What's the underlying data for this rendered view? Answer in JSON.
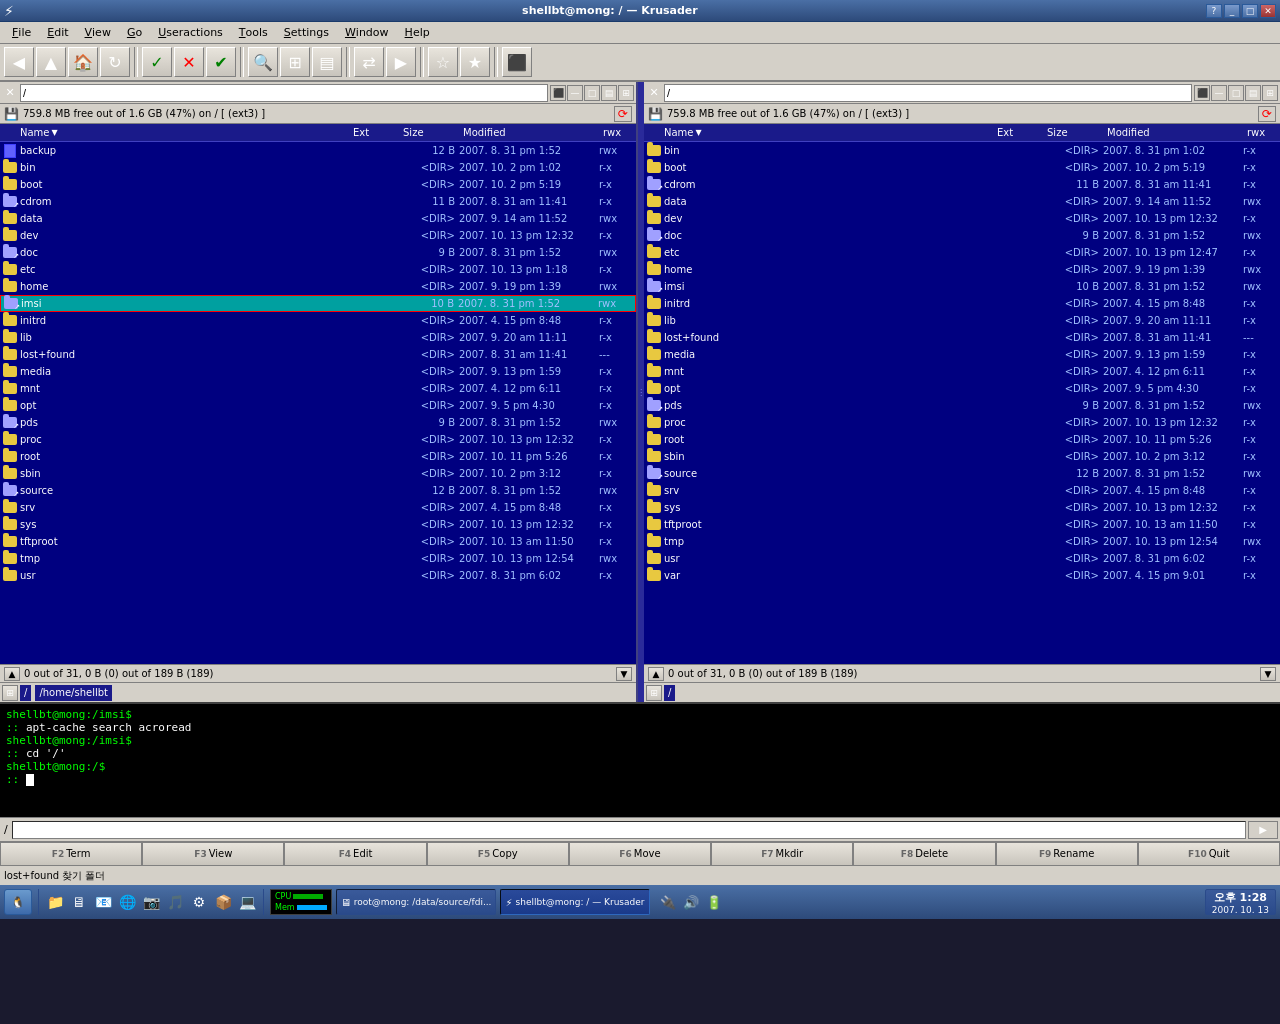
{
  "window": {
    "title": "shellbt@mong: / — Krusader"
  },
  "menubar": {
    "items": [
      "File",
      "Edit",
      "View",
      "Go",
      "Useractions",
      "Tools",
      "Settings",
      "Window",
      "Help"
    ]
  },
  "panels": {
    "left": {
      "path": "/",
      "diskinfo": "759.8 MB free out of 1.6 GB (47%) on / [ (ext3) ]",
      "status": "0 out of 31, 0 B (0) out of 189 B (189)",
      "pathbar1": "/",
      "pathbar2": "/home/shellbt",
      "columns": {
        "name": "Name",
        "ext": "Ext",
        "size": "Size",
        "modified": "Modified",
        "perms": "rwx"
      },
      "files": [
        {
          "name": "backup",
          "ext": "",
          "size": "12 B",
          "modified": "2007. 8. 31 pm 1:52",
          "perms": "rwx",
          "type": "file",
          "selected": false
        },
        {
          "name": "bin",
          "ext": "",
          "size": "<DIR>",
          "modified": "2007. 10. 2 pm 1:02",
          "perms": "r-x",
          "type": "folder",
          "selected": false
        },
        {
          "name": "boot",
          "ext": "",
          "size": "<DIR>",
          "modified": "2007. 10. 2 pm 5:19",
          "perms": "r-x",
          "type": "folder",
          "selected": false
        },
        {
          "name": "cdrom",
          "ext": "",
          "size": "11 B",
          "modified": "2007. 8. 31 am 11:41",
          "perms": "r-x",
          "type": "link",
          "selected": false
        },
        {
          "name": "data",
          "ext": "",
          "size": "<DIR>",
          "modified": "2007. 9. 14 am 11:52",
          "perms": "rwx",
          "type": "folder",
          "selected": false
        },
        {
          "name": "dev",
          "ext": "",
          "size": "<DIR>",
          "modified": "2007. 10. 13 pm 12:32",
          "perms": "r-x",
          "type": "folder",
          "selected": false
        },
        {
          "name": "doc",
          "ext": "",
          "size": "9 B",
          "modified": "2007. 8. 31 pm 1:52",
          "perms": "rwx",
          "type": "link",
          "selected": false
        },
        {
          "name": "etc",
          "ext": "",
          "size": "<DIR>",
          "modified": "2007. 10. 13 pm 1:18",
          "perms": "r-x",
          "type": "folder",
          "selected": false
        },
        {
          "name": "home",
          "ext": "",
          "size": "<DIR>",
          "modified": "2007. 9. 19 pm 1:39",
          "perms": "rwx",
          "type": "folder",
          "selected": false
        },
        {
          "name": "imsi",
          "ext": "",
          "size": "10 B",
          "modified": "2007. 8. 31 pm 1:52",
          "perms": "rwx",
          "type": "link",
          "selected": true,
          "highlighted": true
        },
        {
          "name": "initrd",
          "ext": "",
          "size": "<DIR>",
          "modified": "2007. 4. 15 pm 8:48",
          "perms": "r-x",
          "type": "folder",
          "selected": false
        },
        {
          "name": "lib",
          "ext": "",
          "size": "<DIR>",
          "modified": "2007. 9. 20 am 11:11",
          "perms": "r-x",
          "type": "folder",
          "selected": false
        },
        {
          "name": "lost+found",
          "ext": "",
          "size": "<DIR>",
          "modified": "2007. 8. 31 am 11:41",
          "perms": "---",
          "type": "folder",
          "selected": false
        },
        {
          "name": "media",
          "ext": "",
          "size": "<DIR>",
          "modified": "2007. 9. 13 pm 1:59",
          "perms": "r-x",
          "type": "folder",
          "selected": false
        },
        {
          "name": "mnt",
          "ext": "",
          "size": "<DIR>",
          "modified": "2007. 4. 12 pm 6:11",
          "perms": "r-x",
          "type": "folder",
          "selected": false
        },
        {
          "name": "opt",
          "ext": "",
          "size": "<DIR>",
          "modified": "2007. 9. 5 pm 4:30",
          "perms": "r-x",
          "type": "folder",
          "selected": false
        },
        {
          "name": "pds",
          "ext": "",
          "size": "9 B",
          "modified": "2007. 8. 31 pm 1:52",
          "perms": "rwx",
          "type": "link",
          "selected": false
        },
        {
          "name": "proc",
          "ext": "",
          "size": "<DIR>",
          "modified": "2007. 10. 13 pm 12:32",
          "perms": "r-x",
          "type": "folder",
          "selected": false
        },
        {
          "name": "root",
          "ext": "",
          "size": "<DIR>",
          "modified": "2007. 10. 11 pm 5:26",
          "perms": "r-x",
          "type": "folder",
          "selected": false
        },
        {
          "name": "sbin",
          "ext": "",
          "size": "<DIR>",
          "modified": "2007. 10. 2 pm 3:12",
          "perms": "r-x",
          "type": "folder",
          "selected": false
        },
        {
          "name": "source",
          "ext": "",
          "size": "12 B",
          "modified": "2007. 8. 31 pm 1:52",
          "perms": "rwx",
          "type": "link",
          "selected": false
        },
        {
          "name": "srv",
          "ext": "",
          "size": "<DIR>",
          "modified": "2007. 4. 15 pm 8:48",
          "perms": "r-x",
          "type": "folder",
          "selected": false
        },
        {
          "name": "sys",
          "ext": "",
          "size": "<DIR>",
          "modified": "2007. 10. 13 pm 12:32",
          "perms": "r-x",
          "type": "folder",
          "selected": false
        },
        {
          "name": "tftproot",
          "ext": "",
          "size": "<DIR>",
          "modified": "2007. 10. 13 am 11:50",
          "perms": "r-x",
          "type": "folder",
          "selected": false
        },
        {
          "name": "tmp",
          "ext": "",
          "size": "<DIR>",
          "modified": "2007. 10. 13 pm 12:54",
          "perms": "rwx",
          "type": "folder",
          "selected": false
        },
        {
          "name": "usr",
          "ext": "",
          "size": "<DIR>",
          "modified": "2007. 8. 31 pm 6:02",
          "perms": "r-x",
          "type": "folder",
          "selected": false
        }
      ]
    },
    "right": {
      "path": "/",
      "diskinfo": "759.8 MB free out of 1.6 GB (47%) on / [ (ext3) ]",
      "status": "0 out of 31, 0 B (0) out of 189 B (189)",
      "pathbar1": "/",
      "columns": {
        "name": "Name",
        "ext": "Ext",
        "size": "Size",
        "modified": "Modified",
        "perms": "rwx"
      },
      "files": [
        {
          "name": "bin",
          "ext": "",
          "size": "<DIR>",
          "modified": "2007. 8. 31 pm 1:02",
          "perms": "r-x",
          "type": "folder"
        },
        {
          "name": "boot",
          "ext": "",
          "size": "<DIR>",
          "modified": "2007. 10. 2 pm 5:19",
          "perms": "r-x",
          "type": "folder"
        },
        {
          "name": "cdrom",
          "ext": "",
          "size": "11 B",
          "modified": "2007. 8. 31 am 11:41",
          "perms": "r-x",
          "type": "link"
        },
        {
          "name": "data",
          "ext": "",
          "size": "<DIR>",
          "modified": "2007. 9. 14 am 11:52",
          "perms": "rwx",
          "type": "folder"
        },
        {
          "name": "dev",
          "ext": "",
          "size": "<DIR>",
          "modified": "2007. 10. 13 pm 12:32",
          "perms": "r-x",
          "type": "folder"
        },
        {
          "name": "doc",
          "ext": "",
          "size": "9 B",
          "modified": "2007. 8. 31 pm 1:52",
          "perms": "rwx",
          "type": "link"
        },
        {
          "name": "etc",
          "ext": "",
          "size": "<DIR>",
          "modified": "2007. 10. 13 pm 12:47",
          "perms": "r-x",
          "type": "folder"
        },
        {
          "name": "home",
          "ext": "",
          "size": "<DIR>",
          "modified": "2007. 9. 19 pm 1:39",
          "perms": "rwx",
          "type": "folder"
        },
        {
          "name": "imsi",
          "ext": "",
          "size": "10 B",
          "modified": "2007. 8. 31 pm 1:52",
          "perms": "rwx",
          "type": "link"
        },
        {
          "name": "initrd",
          "ext": "",
          "size": "<DIR>",
          "modified": "2007. 4. 15 pm 8:48",
          "perms": "r-x",
          "type": "folder"
        },
        {
          "name": "lib",
          "ext": "",
          "size": "<DIR>",
          "modified": "2007. 9. 20 am 11:11",
          "perms": "r-x",
          "type": "folder"
        },
        {
          "name": "lost+found",
          "ext": "",
          "size": "<DIR>",
          "modified": "2007. 8. 31 am 11:41",
          "perms": "---",
          "type": "folder"
        },
        {
          "name": "media",
          "ext": "",
          "size": "<DIR>",
          "modified": "2007. 9. 13 pm 1:59",
          "perms": "r-x",
          "type": "folder"
        },
        {
          "name": "mnt",
          "ext": "",
          "size": "<DIR>",
          "modified": "2007. 4. 12 pm 6:11",
          "perms": "r-x",
          "type": "folder"
        },
        {
          "name": "opt",
          "ext": "",
          "size": "<DIR>",
          "modified": "2007. 9. 5 pm 4:30",
          "perms": "r-x",
          "type": "folder"
        },
        {
          "name": "pds",
          "ext": "",
          "size": "9 B",
          "modified": "2007. 8. 31 pm 1:52",
          "perms": "rwx",
          "type": "link"
        },
        {
          "name": "proc",
          "ext": "",
          "size": "<DIR>",
          "modified": "2007. 10. 13 pm 12:32",
          "perms": "r-x",
          "type": "folder"
        },
        {
          "name": "root",
          "ext": "",
          "size": "<DIR>",
          "modified": "2007. 10. 11 pm 5:26",
          "perms": "r-x",
          "type": "folder"
        },
        {
          "name": "sbin",
          "ext": "",
          "size": "<DIR>",
          "modified": "2007. 10. 2 pm 3:12",
          "perms": "r-x",
          "type": "folder"
        },
        {
          "name": "source",
          "ext": "",
          "size": "12 B",
          "modified": "2007. 8. 31 pm 1:52",
          "perms": "rwx",
          "type": "link"
        },
        {
          "name": "srv",
          "ext": "",
          "size": "<DIR>",
          "modified": "2007. 4. 15 pm 8:48",
          "perms": "r-x",
          "type": "folder"
        },
        {
          "name": "sys",
          "ext": "",
          "size": "<DIR>",
          "modified": "2007. 10. 13 pm 12:32",
          "perms": "r-x",
          "type": "folder"
        },
        {
          "name": "tftproot",
          "ext": "",
          "size": "<DIR>",
          "modified": "2007. 10. 13 am 11:50",
          "perms": "r-x",
          "type": "folder"
        },
        {
          "name": "tmp",
          "ext": "",
          "size": "<DIR>",
          "modified": "2007. 10. 13 pm 12:54",
          "perms": "rwx",
          "type": "folder"
        },
        {
          "name": "usr",
          "ext": "",
          "size": "<DIR>",
          "modified": "2007. 8. 31 pm 6:02",
          "perms": "r-x",
          "type": "folder"
        },
        {
          "name": "var",
          "ext": "",
          "size": "<DIR>",
          "modified": "2007. 4. 15 pm 9:01",
          "perms": "r-x",
          "type": "folder"
        }
      ]
    }
  },
  "terminal": {
    "lines": [
      {
        "prompt": "shellbt@mong:/imsi$",
        "cmd": ""
      },
      {
        "prompt": "::",
        "cmd": " apt-cache search acroread"
      },
      {
        "prompt": "shellbt@mong:/imsi$",
        "cmd": ""
      },
      {
        "prompt": "::",
        "cmd": " cd '/'"
      },
      {
        "prompt": "shellbt@mong:/$",
        "cmd": ""
      },
      {
        "prompt": "::",
        "cmd": " "
      }
    ]
  },
  "fkeys": [
    {
      "num": "F2",
      "label": "Term"
    },
    {
      "num": "F3",
      "label": "View"
    },
    {
      "num": "F4",
      "label": "Edit"
    },
    {
      "num": "F5",
      "label": "Copy"
    },
    {
      "num": "F6",
      "label": "Move"
    },
    {
      "num": "F7",
      "label": "Mkdir"
    },
    {
      "num": "F8",
      "label": "Delete"
    },
    {
      "num": "F9",
      "label": "Rename"
    },
    {
      "num": "F10",
      "label": "Quit"
    }
  ],
  "statusbar": {
    "text": "lost+found  찾기 폴더"
  },
  "taskbar": {
    "clock": "오후 1:28",
    "date": "2007. 10. 13",
    "task1": "root@mong: /data/source/fdi...",
    "task2": "shellbt@mong: / — Krusader"
  }
}
